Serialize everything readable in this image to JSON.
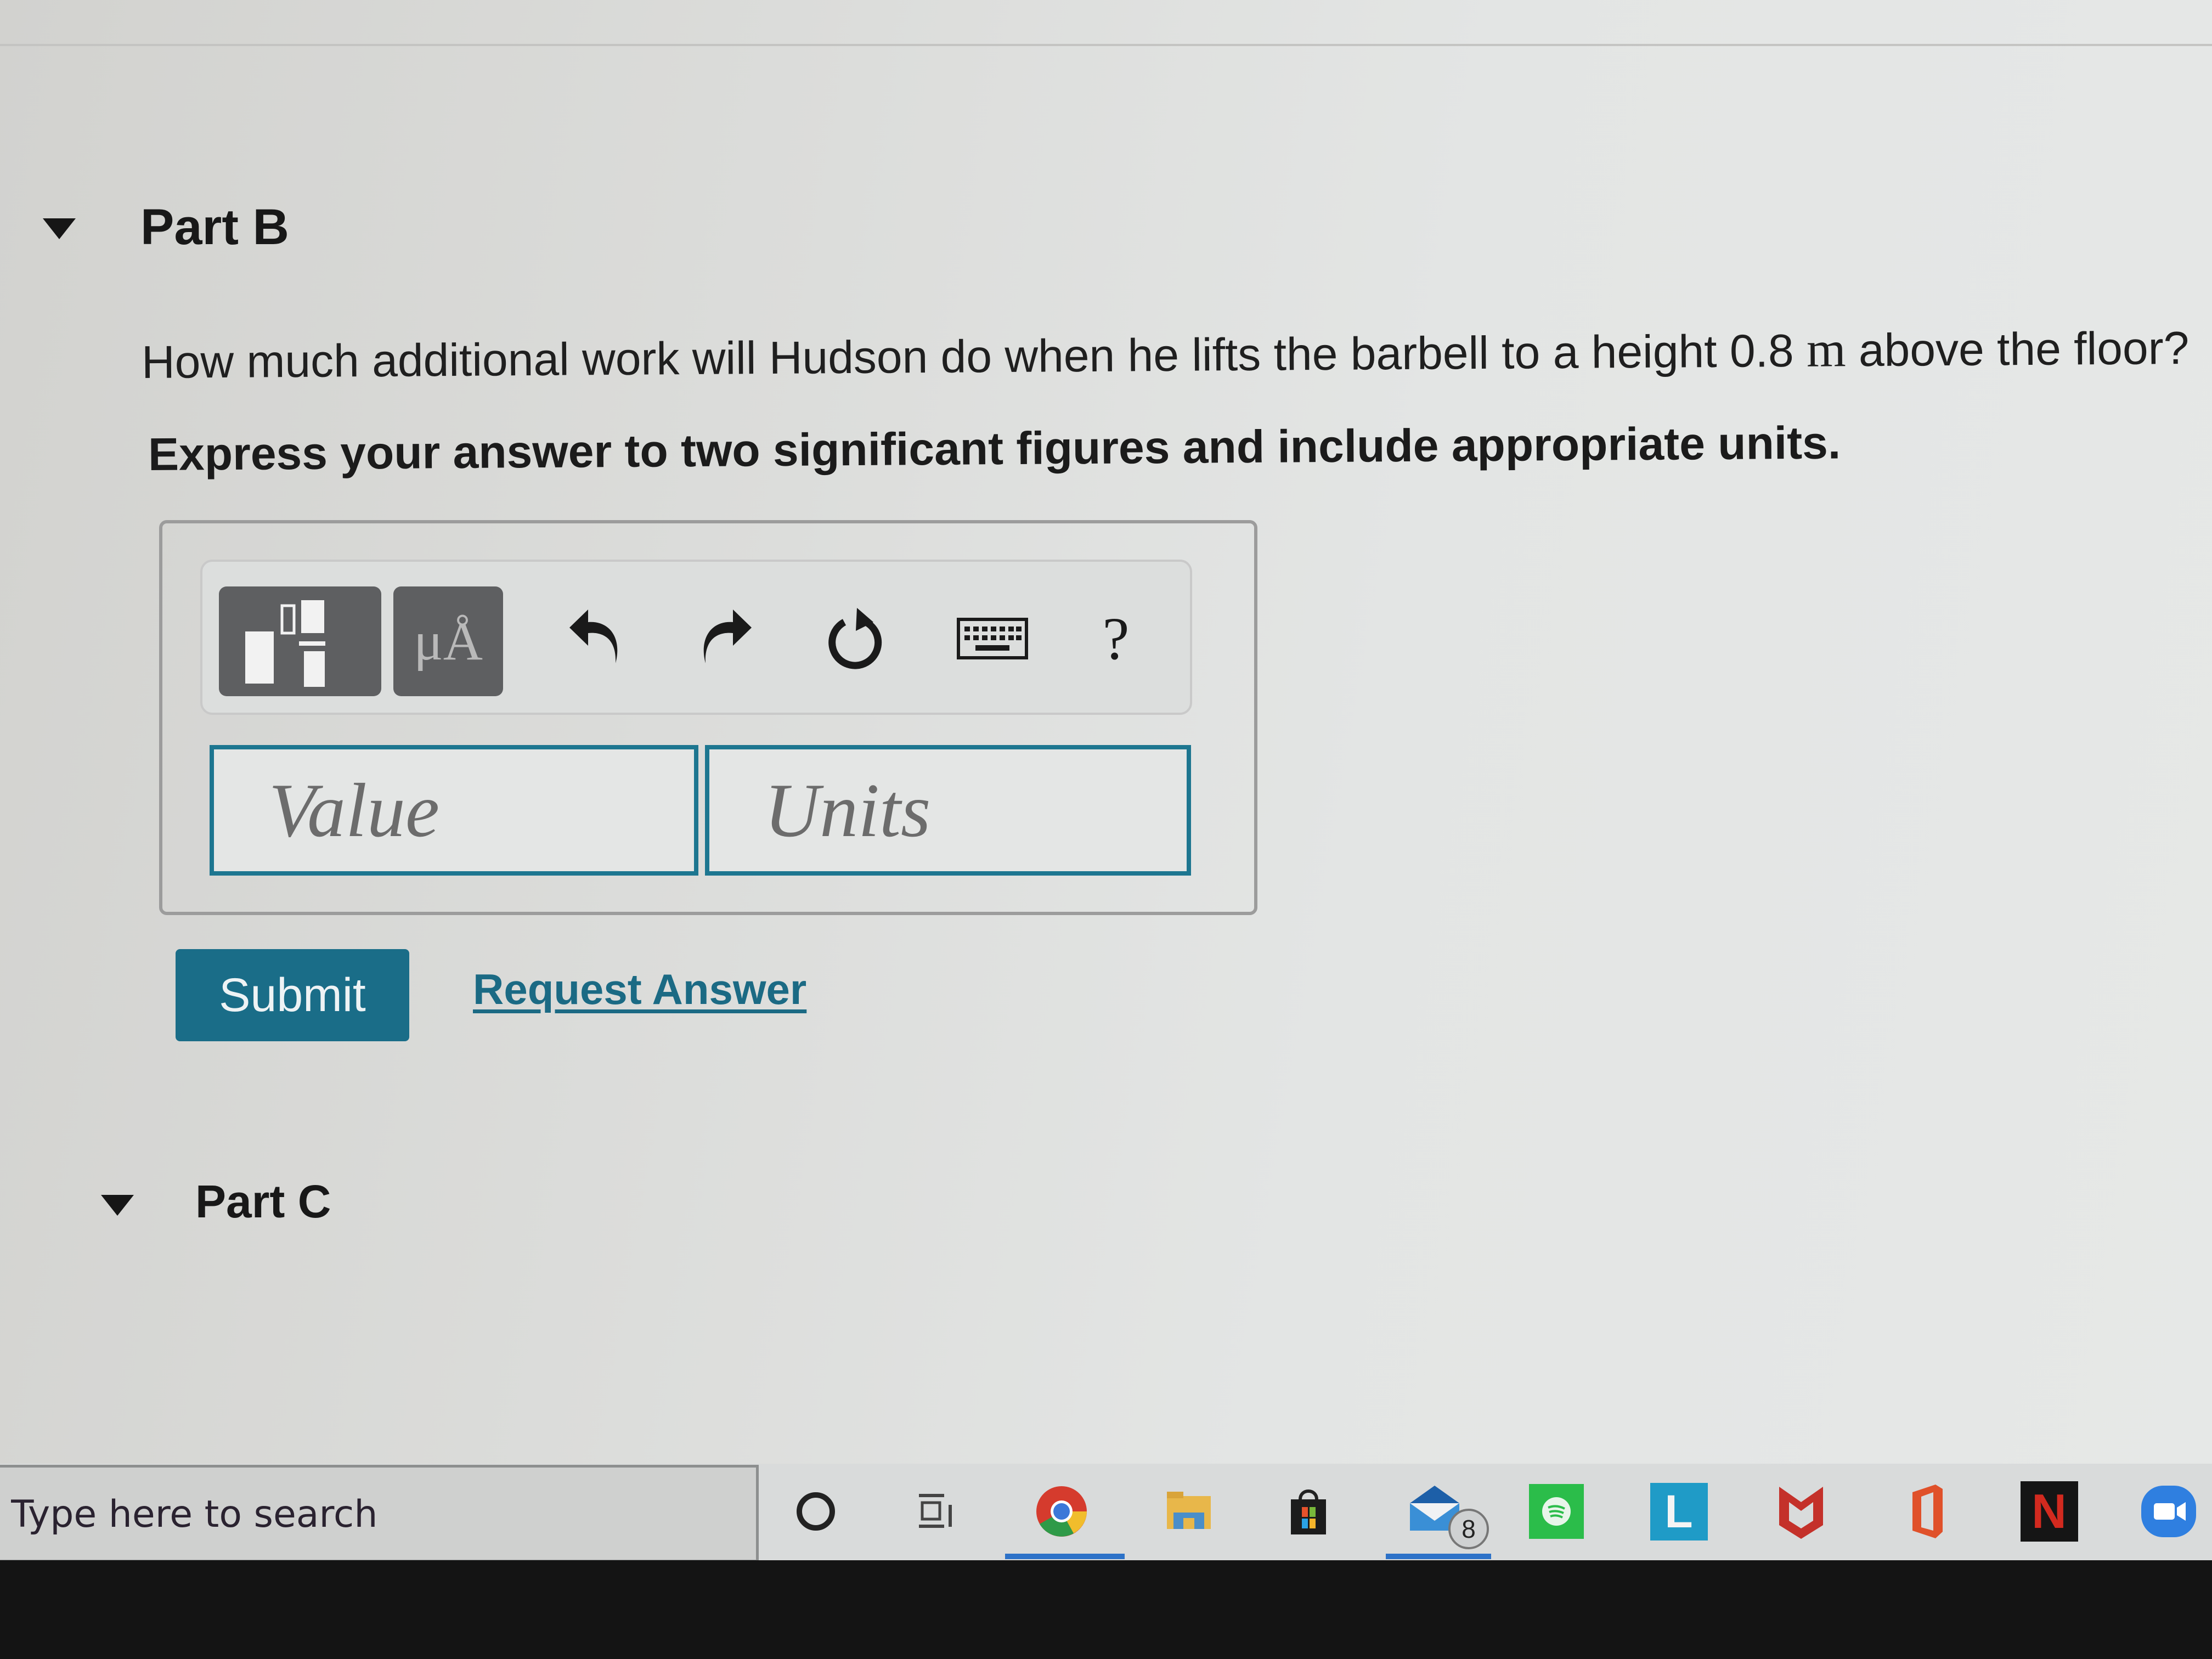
{
  "part_b": {
    "title": "Part B",
    "question_pre": "How much additional work will Hudson do when he lifts the barbell to a height 0.8 ",
    "question_unit": "m",
    "question_post": " above the floor?",
    "instruction": "Express your answer to two significant figures and include appropriate units.",
    "toolbar": {
      "templates_icon": "templates-icon",
      "units_label": "μÅ",
      "undo_icon": "undo-icon",
      "redo_icon": "redo-icon",
      "reset_icon": "reset-icon",
      "keyboard_icon": "keyboard-icon",
      "help_label": "?"
    },
    "value_field": {
      "value": "",
      "placeholder": "Value"
    },
    "units_field": {
      "value": "",
      "placeholder": "Units"
    },
    "submit_label": "Submit",
    "request_answer_label": "Request Answer"
  },
  "part_c": {
    "title": "Part C"
  },
  "taskbar": {
    "search_placeholder": "Type here to search",
    "apps": [
      {
        "name": "cortana",
        "icon": "cortana-icon"
      },
      {
        "name": "task-view",
        "icon": "task-view-icon"
      },
      {
        "name": "chrome",
        "icon": "chrome-icon",
        "active": true
      },
      {
        "name": "file-explorer",
        "icon": "folder-icon"
      },
      {
        "name": "microsoft-store",
        "icon": "store-icon"
      },
      {
        "name": "mail",
        "icon": "mail-icon",
        "badge": "8",
        "active": true
      },
      {
        "name": "spotify",
        "icon": "spotify-icon"
      },
      {
        "name": "l-app",
        "icon": "l-app-icon",
        "label": "L"
      },
      {
        "name": "mcafee",
        "icon": "mcafee-icon"
      },
      {
        "name": "office",
        "icon": "office-icon"
      },
      {
        "name": "netflix",
        "icon": "netflix-icon",
        "label": "N"
      },
      {
        "name": "zoom",
        "icon": "zoom-icon"
      }
    ]
  },
  "colors": {
    "accent": "#1a6d88",
    "field_border": "#1d7690",
    "taskbar_active": "#2d72c8"
  }
}
